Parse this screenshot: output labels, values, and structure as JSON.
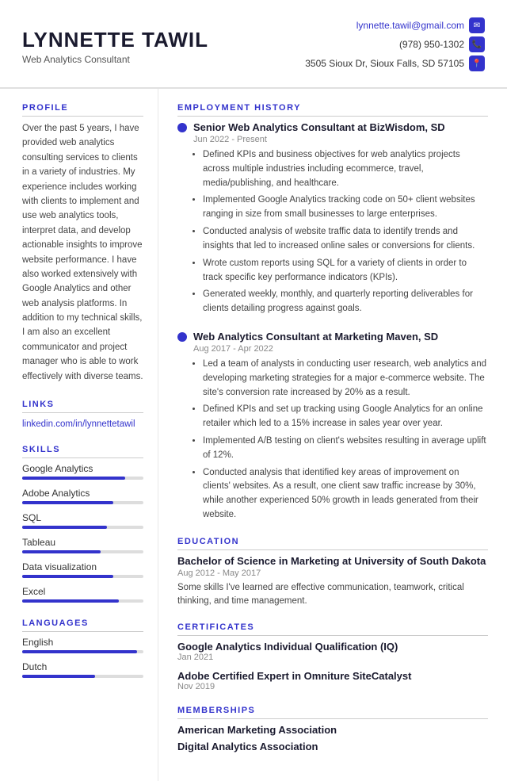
{
  "header": {
    "name": "LYNNETTE TAWIL",
    "title": "Web Analytics Consultant",
    "email": "lynnette.tawil@gmail.com",
    "phone": "(978) 950-1302",
    "address": "3505 Sioux Dr, Sioux Falls, SD 57105"
  },
  "sidebar": {
    "profile_title": "PROFILE",
    "profile_text": "Over the past 5 years, I have provided web analytics consulting services to clients in a variety of industries. My experience includes working with clients to implement and use web analytics tools, interpret data, and develop actionable insights to improve website performance. I have also worked extensively with Google Analytics and other web analysis platforms. In addition to my technical skills, I am also an excellent communicator and project manager who is able to work effectively with diverse teams.",
    "links_title": "LINKS",
    "linkedin": "linkedin.com/in/lynnettetawil",
    "skills_title": "SKILLS",
    "skills": [
      {
        "name": "Google Analytics",
        "pct": 85
      },
      {
        "name": "Adobe Analytics",
        "pct": 75
      },
      {
        "name": "SQL",
        "pct": 70
      },
      {
        "name": "Tableau",
        "pct": 65
      },
      {
        "name": "Data visualization",
        "pct": 75
      },
      {
        "name": "Excel",
        "pct": 80
      }
    ],
    "languages_title": "LANGUAGES",
    "languages": [
      {
        "name": "English",
        "pct": 95
      },
      {
        "name": "Dutch",
        "pct": 60
      }
    ]
  },
  "employment": {
    "section_title": "EMPLOYMENT HISTORY",
    "jobs": [
      {
        "title": "Senior Web Analytics Consultant at BizWisdom, SD",
        "date": "Jun 2022 - Present",
        "bullets": [
          "Defined KPIs and business objectives for web analytics projects across multiple industries including ecommerce, travel, media/publishing, and healthcare.",
          "Implemented Google Analytics tracking code on 50+ client websites ranging in size from small businesses to large enterprises.",
          "Conducted analysis of website traffic data to identify trends and insights that led to increased online sales or conversions for clients.",
          "Wrote custom reports using SQL for a variety of clients in order to track specific key performance indicators (KPIs).",
          "Generated weekly, monthly, and quarterly reporting deliverables for clients detailing progress against goals."
        ]
      },
      {
        "title": "Web Analytics Consultant at Marketing Maven, SD",
        "date": "Aug 2017 - Apr 2022",
        "bullets": [
          "Led a team of analysts in conducting user research, web analytics and developing marketing strategies for a major e-commerce website. The site's conversion rate increased by 20% as a result.",
          "Defined KPIs and set up tracking using Google Analytics for an online retailer which led to a 15% increase in sales year over year.",
          "Implemented A/B testing on client's websites resulting in average uplift of 12%.",
          "Conducted analysis that identified key areas of improvement on clients' websites. As a result, one client saw traffic increase by 30%, while another experienced 50% growth in leads generated from their website."
        ]
      }
    ]
  },
  "education": {
    "section_title": "EDUCATION",
    "items": [
      {
        "title": "Bachelor of Science in Marketing at University of South Dakota",
        "date": "Aug 2012 - May 2017",
        "desc": "Some skills I've learned are effective communication, teamwork, critical thinking, and time management."
      }
    ]
  },
  "certificates": {
    "section_title": "CERTIFICATES",
    "items": [
      {
        "title": "Google Analytics Individual Qualification (IQ)",
        "date": "Jan 2021"
      },
      {
        "title": "Adobe Certified Expert in Omniture SiteCatalyst",
        "date": "Nov 2019"
      }
    ]
  },
  "memberships": {
    "section_title": "MEMBERSHIPS",
    "items": [
      "American Marketing Association",
      "Digital Analytics Association"
    ]
  }
}
